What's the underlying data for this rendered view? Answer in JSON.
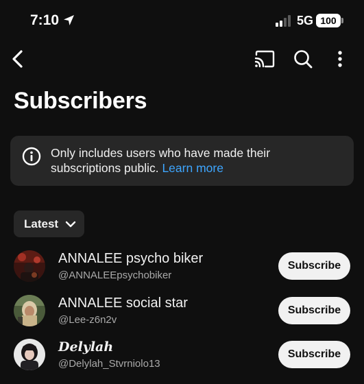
{
  "status_bar": {
    "time": "7:10",
    "network": "5G",
    "battery": "100",
    "icons": [
      "location-arrow-icon",
      "cellular-signal-icon",
      "battery-icon"
    ]
  },
  "nav": {
    "icons": [
      "back-arrow-icon",
      "cast-icon",
      "search-icon",
      "more-vertical-icon"
    ]
  },
  "page": {
    "title": "Subscribers"
  },
  "info": {
    "icon": "info-icon",
    "text": "Only includes users who have made their subscriptions public.",
    "link": "Learn more"
  },
  "sort": {
    "selected": "Latest",
    "icon": "chevron-down-icon"
  },
  "subscribers": [
    {
      "name": "ANNALEE psycho biker",
      "handle": "@ANNALEEpsychobiker",
      "button": "Subscribe"
    },
    {
      "name": "ANNALEE social star",
      "handle": "@Lee-z6n2v",
      "button": "Subscribe"
    },
    {
      "name": "Delylah",
      "handle": "@Delylah_Stvrniolo13",
      "button": "Subscribe"
    }
  ],
  "colors": {
    "background": "#0f0f0f",
    "surface": "#272727",
    "text_primary": "#f1f1f1",
    "text_secondary": "#aaaaaa",
    "link": "#3ea6ff",
    "button_bg": "#f1f1f1"
  }
}
